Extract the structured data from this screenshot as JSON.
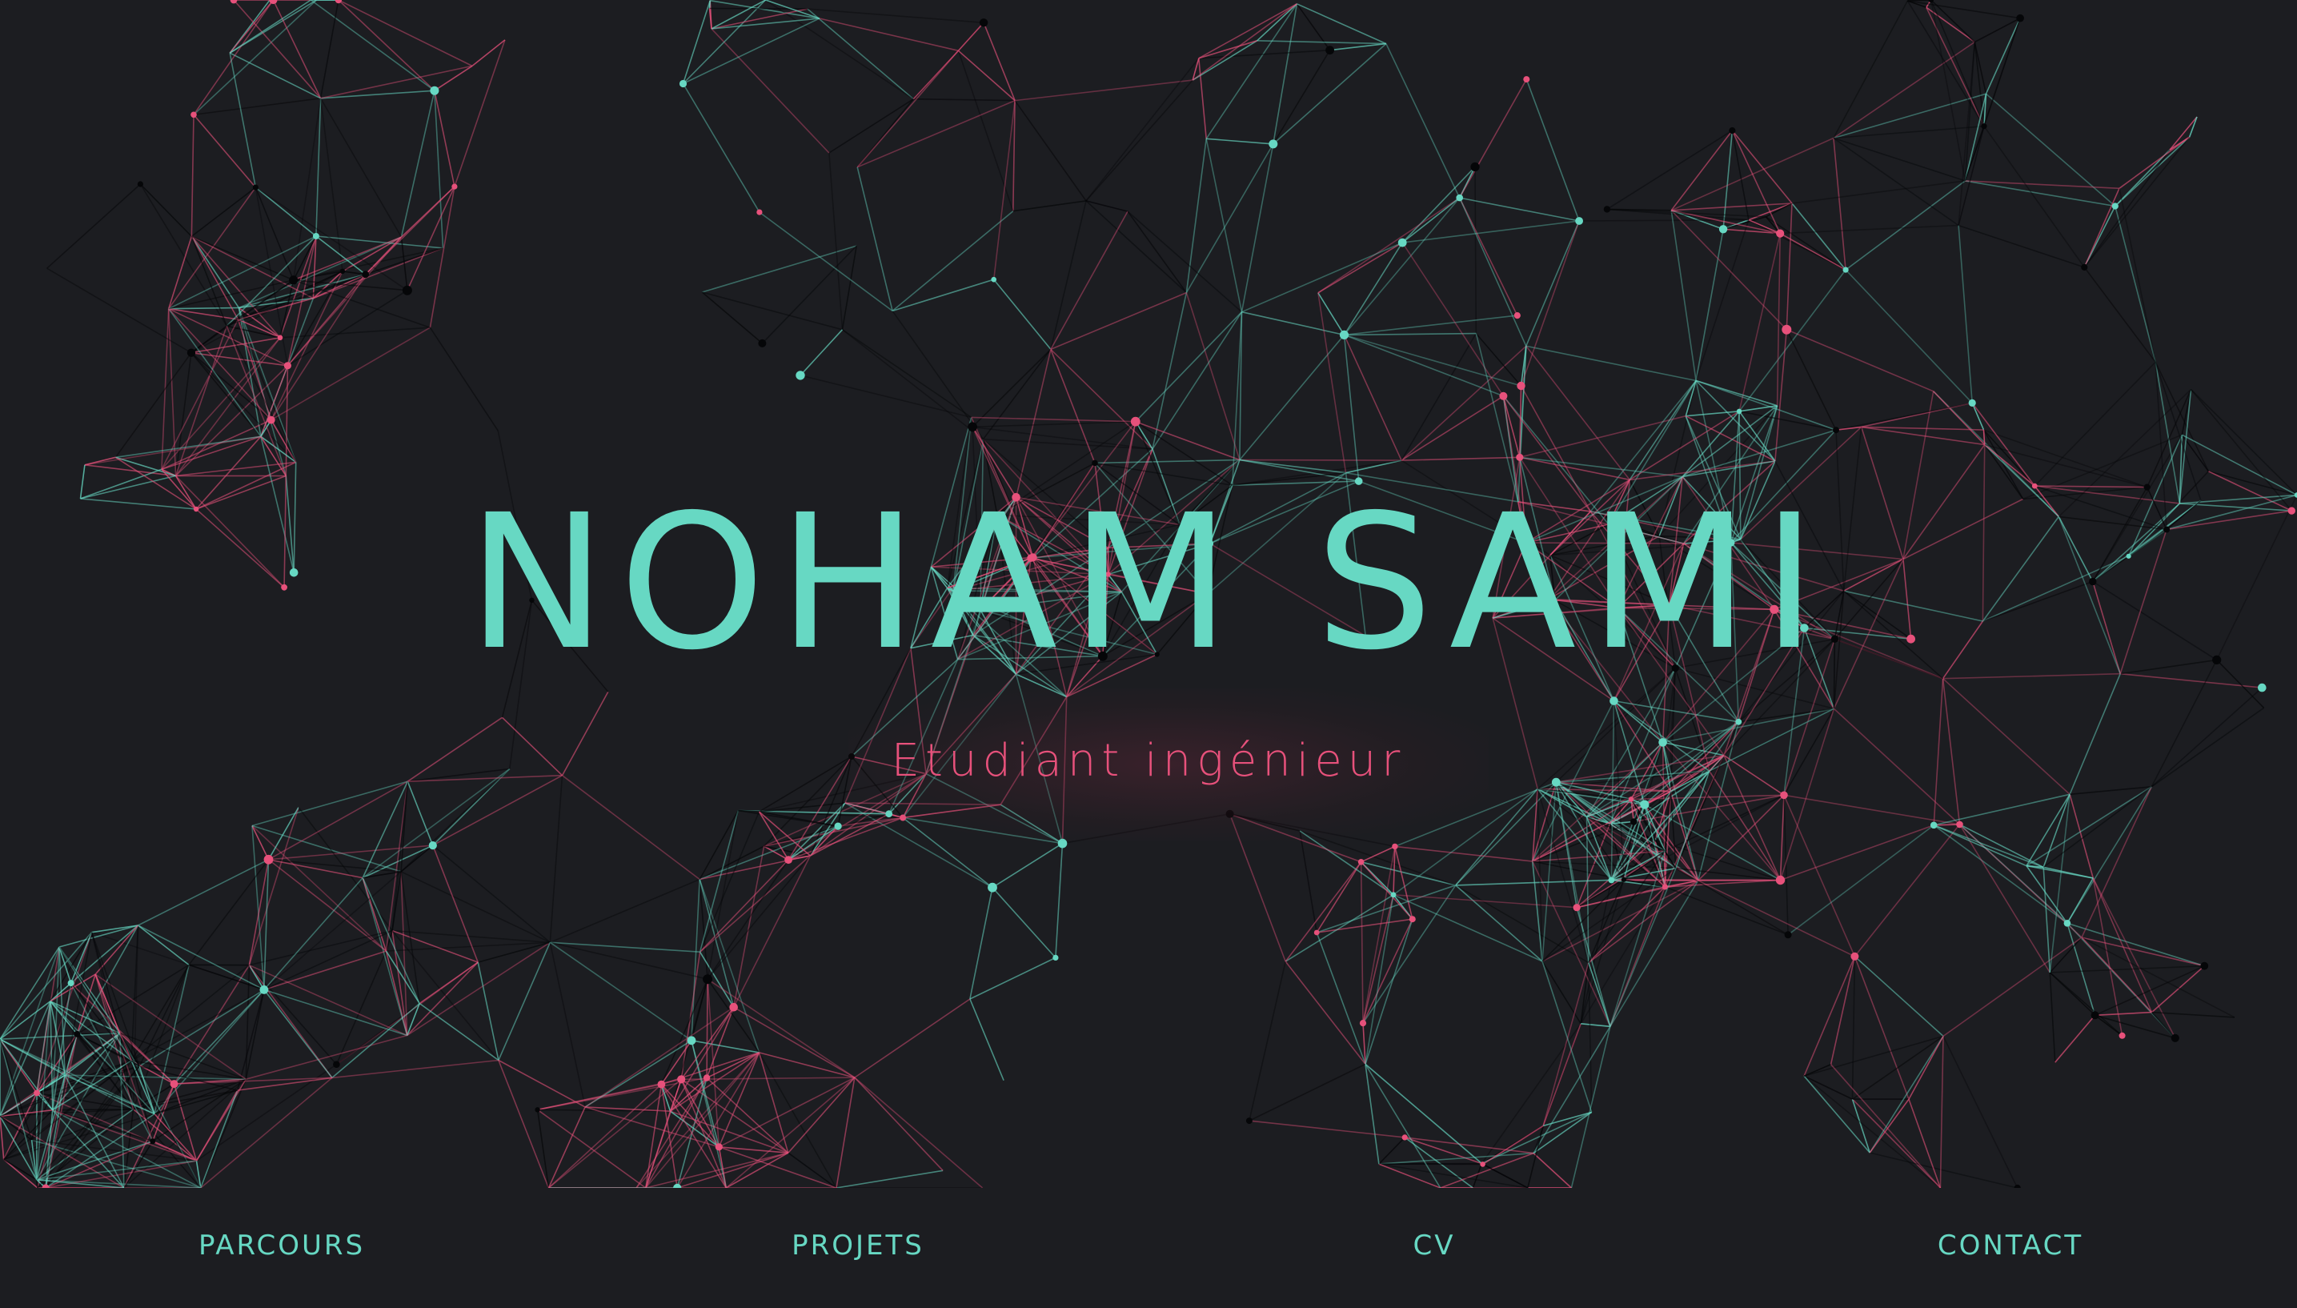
{
  "hero": {
    "name": "NOHAM SAMI",
    "subtitle": "Etudiant ingénieur"
  },
  "nav": {
    "items": [
      {
        "label": "PARCOURS"
      },
      {
        "label": "PROJETS"
      },
      {
        "label": "CV"
      },
      {
        "label": "CONTACT"
      }
    ]
  },
  "colors": {
    "background": "#1c1d21",
    "teal": "#67d8c3",
    "pink": "#e7517b",
    "dark_line": "#050608"
  }
}
